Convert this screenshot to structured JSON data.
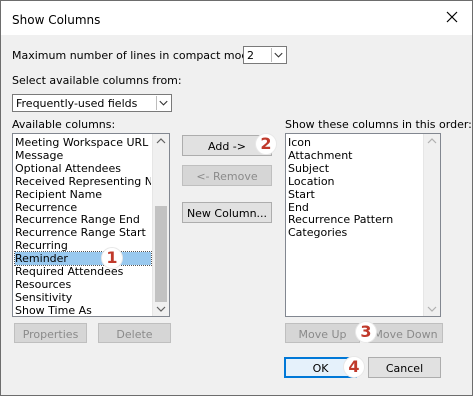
{
  "dialog": {
    "title": "Show Columns"
  },
  "max_lines": {
    "label": "Maximum number of lines in compact mode:",
    "value": "2"
  },
  "source": {
    "label": "Select available columns from:",
    "value": "Frequently-used fields"
  },
  "available": {
    "label": "Available columns:",
    "items": [
      "Meeting Workspace URL",
      "Message",
      "Optional Attendees",
      "Received Representing Na",
      "Recipient Name",
      "Recurrence",
      "Recurrence Range End",
      "Recurrence Range Start",
      "Recurring",
      "Reminder",
      "Required Attendees",
      "Resources",
      "Sensitivity",
      "Show Time As"
    ],
    "selected": "Reminder"
  },
  "shown": {
    "label": "Show these columns in this order:",
    "items": [
      "Icon",
      "Attachment",
      "Subject",
      "Location",
      "Start",
      "End",
      "Recurrence Pattern",
      "Categories"
    ]
  },
  "buttons": {
    "add": "Add ->",
    "remove": "<- Remove",
    "new_column": "New Column...",
    "properties": "Properties",
    "delete": "Delete",
    "move_up": "Move Up",
    "move_down": "Move Down",
    "ok": "OK",
    "cancel": "Cancel"
  },
  "markers": [
    "1",
    "2",
    "3",
    "4"
  ],
  "colors": {
    "marker": "#c0392b",
    "selection": "#99c9ef",
    "default_button_border": "#0078d7"
  }
}
